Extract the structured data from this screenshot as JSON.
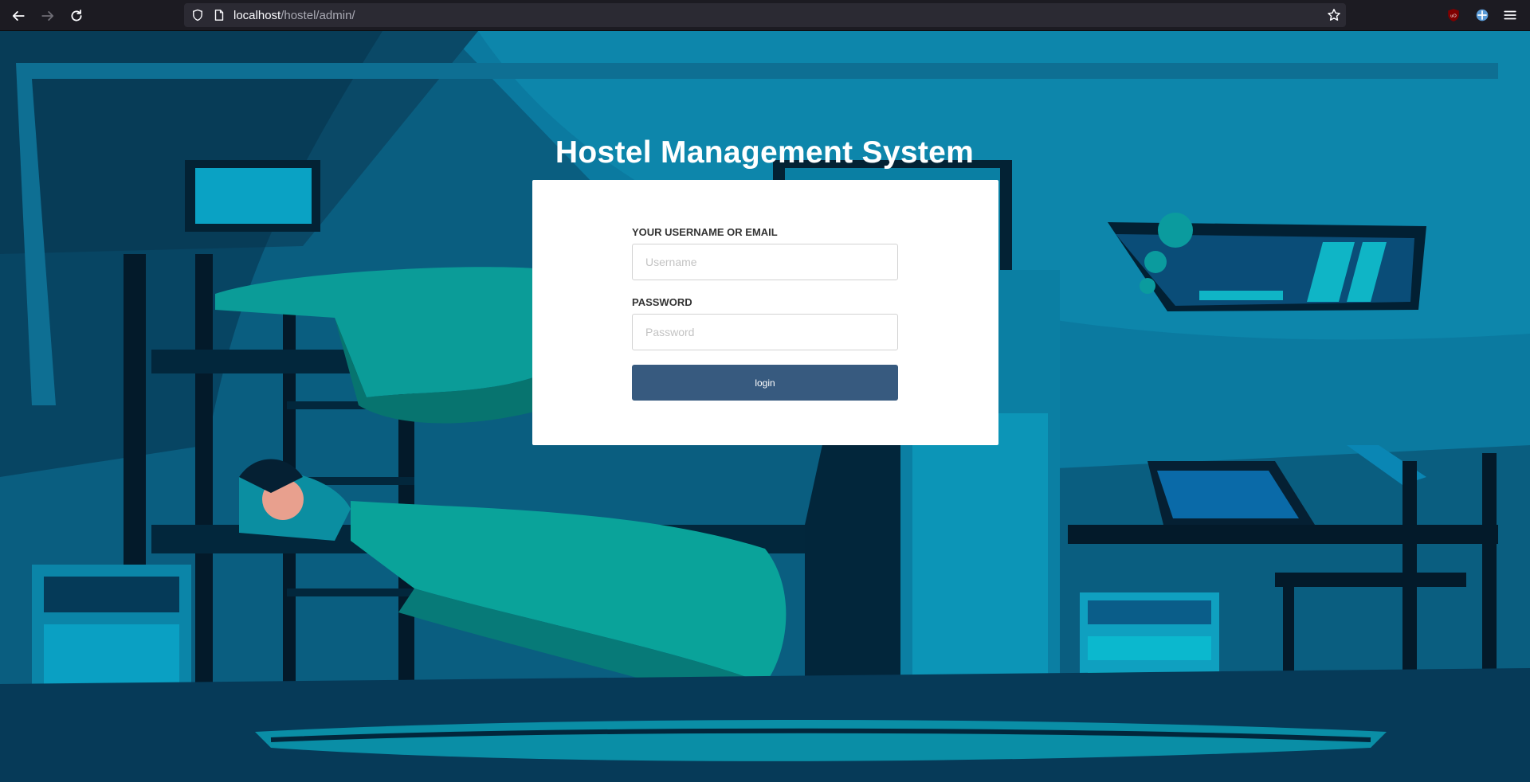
{
  "browser": {
    "url_host": "localhost",
    "url_path": "/hostel/admin/",
    "icons": [
      "back-arrow-icon",
      "forward-arrow-icon",
      "reload-icon",
      "shield-icon",
      "page-icon",
      "star-icon",
      "ublock-icon",
      "extension-icon",
      "menu-icon"
    ]
  },
  "page": {
    "title": "Hostel Management System"
  },
  "form": {
    "username_label": "YOUR USERNAME OR EMAIL",
    "username_placeholder": "Username",
    "username_value": "",
    "password_label": "PASSWORD",
    "password_placeholder": "Password",
    "password_value": "",
    "login_label": "login"
  },
  "colors": {
    "button": "#375a7f",
    "background": "#0b3a55",
    "card": "#ffffff"
  }
}
